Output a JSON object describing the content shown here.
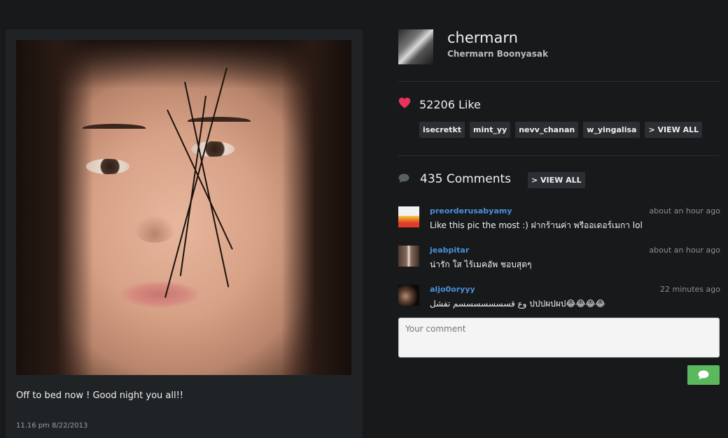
{
  "post": {
    "caption": "Off to bed now ! Good night you all!!",
    "timestamp": "11.16 pm 8/22/2013"
  },
  "profile": {
    "username": "chermarn",
    "full_name": "Chermarn Boonyasak"
  },
  "likes": {
    "label": "52206 Like",
    "tags": [
      "isecretkt",
      "mint_yy",
      "nevv_chanan",
      "w_yingalisa"
    ],
    "view_all": "> VIEW ALL"
  },
  "comments": {
    "label": "435 Comments",
    "view_all": "> VIEW ALL",
    "items": [
      {
        "user": "preorderusabyamy",
        "time": "about an hour ago",
        "text": "Like this pic the most :) ฝากร้านค่า พรีออเดอร์เมกา lol"
      },
      {
        "user": "jeabpitar",
        "time": "about an hour ago",
        "text": "น่ารัก ใส ไร้เมคอัพ ชอบสุดๆ"
      },
      {
        "user": "aljo0oryyy",
        "time": "22 minutes ago",
        "text": "وع قسسسسسسسم تفشل ปปปผปผป😂😂😂😂"
      }
    ]
  },
  "composer": {
    "placeholder": "Your comment"
  },
  "colors": {
    "background": "#17191b",
    "card": "#1f2326",
    "accent_heart": "#e8335a",
    "link_blue": "#4a90d9",
    "send_green": "#5cb85c"
  },
  "icons": {
    "likes": "heart-icon",
    "comments": "speech-bubble-icon",
    "send": "speech-bubble-icon"
  }
}
